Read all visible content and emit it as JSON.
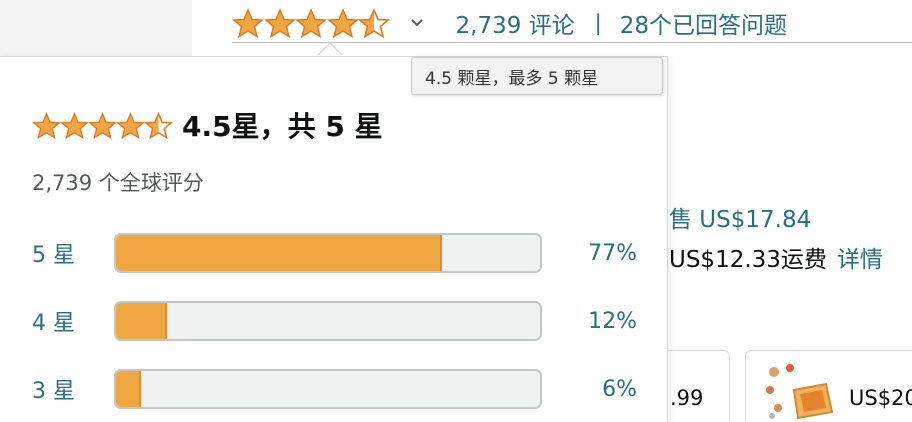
{
  "rating_summary": {
    "review_count_link": "2,739 评论",
    "separator": "|",
    "answered_questions_link": "28个已回答问题",
    "dropdown_icon": "chevron-down-icon",
    "tooltip": "4.5 颗星，最多 5 颗星"
  },
  "popover": {
    "title": "4.5星，共 5 星",
    "global_ratings": "2,739 个全球评分",
    "histogram": [
      {
        "label": "5 星",
        "percent_text": "77%",
        "value": 0.77
      },
      {
        "label": "4 星",
        "percent_text": "12%",
        "value": 0.12
      },
      {
        "label": "3 星",
        "percent_text": "6%",
        "value": 0.06
      }
    ]
  },
  "stars": {
    "rating": 4.5,
    "max": 5
  },
  "right_panel": {
    "price_line": "售 US$17.84",
    "shipping_line": "US$12.33运费",
    "details_link": "详情",
    "card1_price": ".99",
    "card2_price": "US$20"
  },
  "colors": {
    "star": "#f0a742",
    "bar_fill": "#f0a742",
    "link": "#2a6f80",
    "bar_track": "#f0f2f2"
  }
}
